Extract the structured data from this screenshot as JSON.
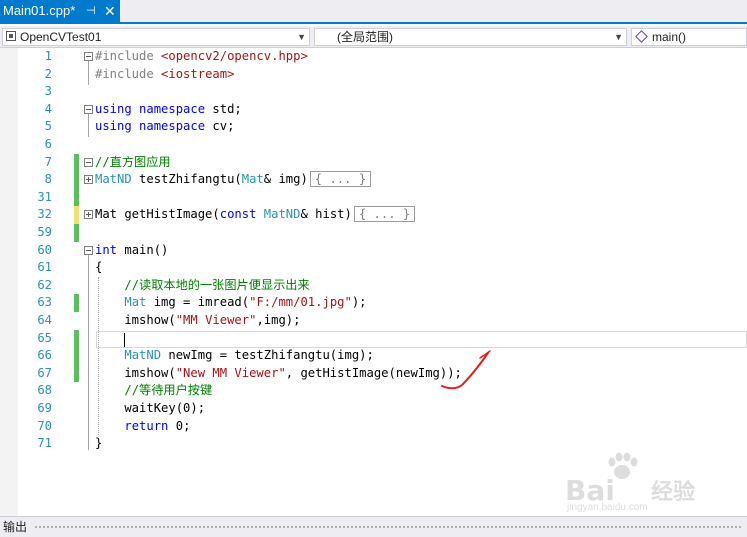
{
  "tab": {
    "title": "Main01.cpp*",
    "pin": "⊣",
    "close": "✕"
  },
  "nav": {
    "project": "OpenCVTest01",
    "scope": "(全局范围)",
    "member": "main()"
  },
  "lines": [
    {
      "num": "1",
      "parts": [
        {
          "t": "#include ",
          "c": "pp"
        },
        {
          "t": "<opencv2/opencv.hpp>",
          "c": "str"
        }
      ]
    },
    {
      "num": "2",
      "parts": [
        {
          "t": "#include ",
          "c": "pp"
        },
        {
          "t": "<iostream>",
          "c": "str"
        }
      ]
    },
    {
      "num": "3",
      "parts": []
    },
    {
      "num": "4",
      "parts": [
        {
          "t": "using",
          "c": "kw"
        },
        {
          "t": " "
        },
        {
          "t": "namespace",
          "c": "kw"
        },
        {
          "t": " std;"
        }
      ]
    },
    {
      "num": "5",
      "parts": [
        {
          "t": "using",
          "c": "kw"
        },
        {
          "t": " "
        },
        {
          "t": "namespace",
          "c": "kw"
        },
        {
          "t": " cv;"
        }
      ]
    },
    {
      "num": "6",
      "parts": []
    },
    {
      "num": "7",
      "parts": [
        {
          "t": "//直方图应用",
          "c": "cm"
        }
      ]
    },
    {
      "num": "8",
      "parts": [
        {
          "t": "MatND",
          "c": "ty"
        },
        {
          "t": " testZhifangtu("
        },
        {
          "t": "Mat",
          "c": "ty"
        },
        {
          "t": "& img)"
        }
      ],
      "collapsed": "{ ... }"
    },
    {
      "num": "31",
      "parts": []
    },
    {
      "num": "32",
      "parts": [
        {
          "t": "Mat getHistImage("
        },
        {
          "t": "const",
          "c": "kw"
        },
        {
          "t": " "
        },
        {
          "t": "MatND",
          "c": "ty"
        },
        {
          "t": "& hist)"
        }
      ],
      "collapsed": "{ ... }"
    },
    {
      "num": "59",
      "parts": []
    },
    {
      "num": "60",
      "parts": [
        {
          "t": "int",
          "c": "kw"
        },
        {
          "t": " main()"
        }
      ]
    },
    {
      "num": "61",
      "parts": [
        {
          "t": "{"
        }
      ]
    },
    {
      "num": "62",
      "parts": [
        {
          "t": "    "
        },
        {
          "t": "//读取本地的一张图片便显示出来",
          "c": "cm"
        }
      ]
    },
    {
      "num": "63",
      "parts": [
        {
          "t": "    "
        },
        {
          "t": "Mat",
          "c": "ty"
        },
        {
          "t": " img = imread("
        },
        {
          "t": "\"F:/mm/01.jpg\"",
          "c": "str"
        },
        {
          "t": ");"
        }
      ]
    },
    {
      "num": "64",
      "parts": [
        {
          "t": "    imshow("
        },
        {
          "t": "\"MM Viewer\"",
          "c": "str"
        },
        {
          "t": ",img);"
        }
      ]
    },
    {
      "num": "65",
      "parts": []
    },
    {
      "num": "66",
      "parts": [
        {
          "t": "    "
        },
        {
          "t": "MatND",
          "c": "ty"
        },
        {
          "t": " newImg = testZhifangtu(img);"
        }
      ]
    },
    {
      "num": "67",
      "parts": [
        {
          "t": "    imshow("
        },
        {
          "t": "\"New MM Viewer\"",
          "c": "str"
        },
        {
          "t": ", getHistImage(newImg));"
        }
      ]
    },
    {
      "num": "68",
      "parts": [
        {
          "t": "    "
        },
        {
          "t": "//等待用户按键",
          "c": "cm"
        }
      ]
    },
    {
      "num": "69",
      "parts": [
        {
          "t": "    waitKey(0);"
        }
      ]
    },
    {
      "num": "70",
      "parts": [
        {
          "t": "    "
        },
        {
          "t": "return",
          "c": "kw"
        },
        {
          "t": " 0;"
        }
      ]
    },
    {
      "num": "71",
      "parts": [
        {
          "t": "}"
        }
      ]
    }
  ],
  "status": {
    "output_label": "输出"
  },
  "watermark": {
    "brand": "Bai",
    "brand2": "经验",
    "url": "jingyan.baidu.com"
  },
  "colors": {
    "accent": "#007acc",
    "keyword": "#0000ff",
    "string": "#a31515",
    "comment": "#008000",
    "type": "#2b91af",
    "changed": "#57c15a",
    "saved_changed": "#f5e06a",
    "annotation": "#e0201a"
  }
}
